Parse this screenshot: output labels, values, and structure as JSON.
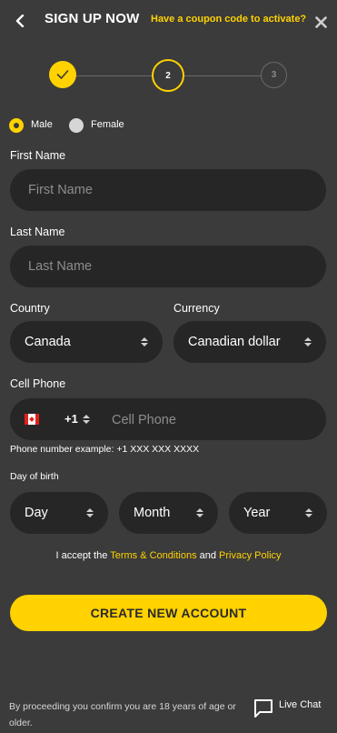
{
  "header": {
    "title": "SIGN UP NOW",
    "coupon_link": "Have a coupon code to activate?"
  },
  "stepper": {
    "steps": [
      {
        "label": "",
        "state": "done"
      },
      {
        "label": "2",
        "state": "current"
      },
      {
        "label": "3",
        "state": "upcoming"
      }
    ]
  },
  "gender": {
    "options": [
      "Male",
      "Female"
    ],
    "selected": "Male"
  },
  "form": {
    "first_name": {
      "label": "First Name",
      "placeholder": "First Name"
    },
    "last_name": {
      "label": "Last Name",
      "placeholder": "Last Name"
    },
    "country": {
      "label": "Country",
      "value": "Canada"
    },
    "currency": {
      "label": "Currency",
      "value": "Canadian dollar"
    },
    "cell_phone": {
      "label": "Cell Phone",
      "dial_code": "+1",
      "placeholder": "Cell Phone",
      "example": "Phone number example: +1 XXX XXX XXXX"
    },
    "dob": {
      "label": "Day of birth",
      "day": "Day",
      "month": "Month",
      "year": "Year"
    }
  },
  "terms": {
    "prefix": "I accept the ",
    "terms_link": "Terms & Conditions",
    "middle": " and ",
    "privacy_link": "Privacy Policy"
  },
  "cta": {
    "label": "CREATE NEW ACCOUNT"
  },
  "footer": {
    "disclaimer": "By proceeding you confirm you are 18 years of age or older.",
    "live_chat": "Live Chat"
  },
  "colors": {
    "accent": "#ffd200",
    "background": "#3b3b3b",
    "field": "#262626"
  }
}
